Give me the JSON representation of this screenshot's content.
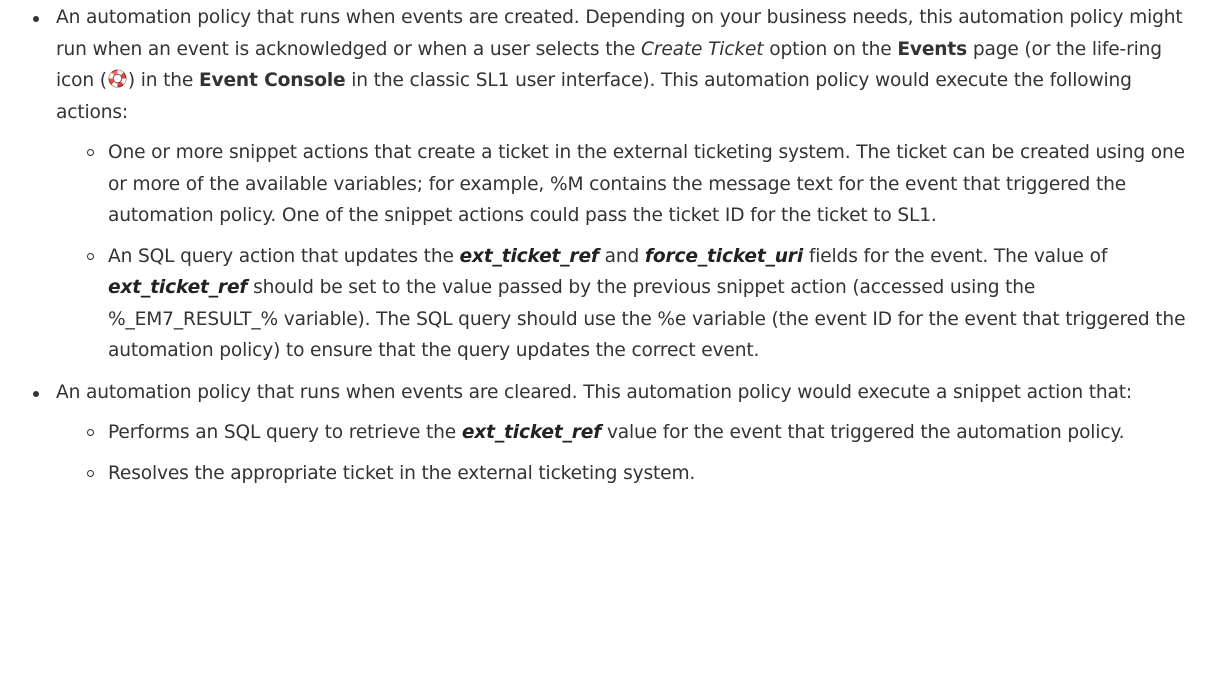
{
  "list": [
    {
      "intro": "An automation policy that runs when events are created. Depending on your business needs, this automation policy might run when an event is acknowledged or when a user selects the ",
      "create_ticket": "Create Ticket",
      "option_on": " option on the ",
      "events": "Events",
      "page_or": " page (or the life-ring icon (",
      "icon": "life-ring-icon",
      "in_the": ") in the ",
      "event_console": "Event Console",
      "tail": " in the classic SL1 user interface). This automation policy would execute the following actions:",
      "subitems": [
        {
          "text": "One or more snippet actions that create a ticket in the external ticketing system. The ticket can be created using one or more of the available variables; for example, %M contains the message text for the event that triggered the automation policy. One of the snippet actions could pass the ticket ID for the ticket to SL1."
        },
        {
          "a": "An SQL query action that updates the ",
          "f1": "ext_ticket_ref",
          "b": " and ",
          "f2": "force_ticket_uri",
          "c": " fields for the event. The value of ",
          "f3": "ext_ticket_ref",
          "d": " should be set to the value passed by the previous snippet action (accessed using the %_EM7_RESULT_% variable). The SQL query should use the %e variable (the event ID for the event that triggered the automation policy) to ensure that the query updates the correct event."
        }
      ]
    },
    {
      "intro": "An automation policy that runs when events are cleared. This automation policy would execute a snippet action that:",
      "subitems": [
        {
          "a": "Performs an SQL query to retrieve the ",
          "f1": "ext_ticket_ref",
          "b": " value for the event that triggered the automation policy."
        },
        {
          "text": "Resolves the appropriate ticket in the external ticketing system."
        }
      ]
    }
  ]
}
